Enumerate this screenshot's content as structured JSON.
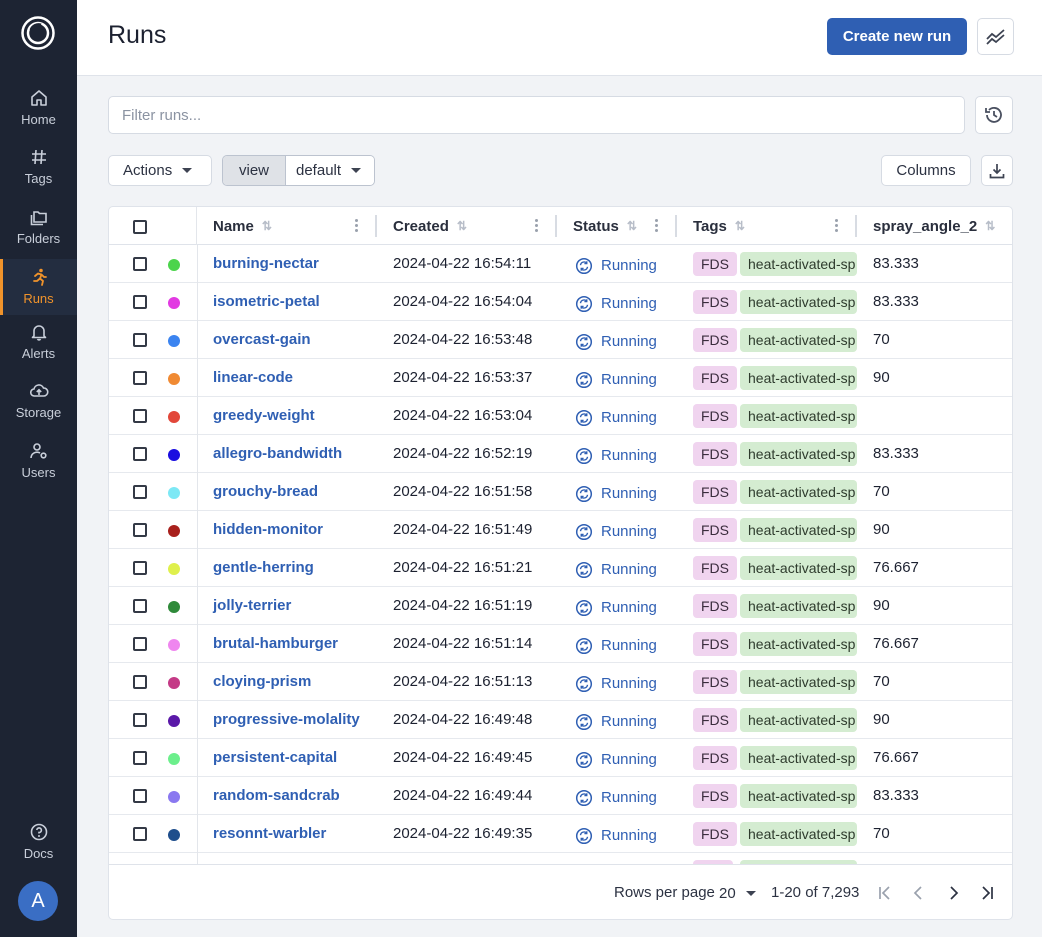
{
  "app": {
    "title": "Runs"
  },
  "sidebar": {
    "items": [
      {
        "label": "Home",
        "icon": "home-icon"
      },
      {
        "label": "Tags",
        "icon": "hash-icon"
      },
      {
        "label": "Folders",
        "icon": "folders-icon"
      },
      {
        "label": "Runs",
        "icon": "runner-icon",
        "active": true
      },
      {
        "label": "Alerts",
        "icon": "bell-icon"
      },
      {
        "label": "Storage",
        "icon": "cloud-upload-icon"
      },
      {
        "label": "Users",
        "icon": "users-cog-icon"
      }
    ],
    "docs_label": "Docs",
    "avatar_initial": "A"
  },
  "header": {
    "title": "Runs",
    "create_button": "Create new run"
  },
  "filter": {
    "placeholder": "Filter runs..."
  },
  "toolbar": {
    "actions_label": "Actions",
    "view_label": "view",
    "view_value": "default",
    "columns_label": "Columns"
  },
  "table": {
    "columns": [
      "Name",
      "Created",
      "Status",
      "Tags",
      "spray_angle_2"
    ],
    "rows": [
      {
        "color": "#4cd44c",
        "name": "burning-nectar",
        "created": "2024-04-22 16:54:11",
        "status": "Running",
        "tag1": "FDS",
        "tag2": "heat-activated-sp",
        "spray": "83.333"
      },
      {
        "color": "#e23ae2",
        "name": "isometric-petal",
        "created": "2024-04-22 16:54:04",
        "status": "Running",
        "tag1": "FDS",
        "tag2": "heat-activated-sp",
        "spray": "83.333"
      },
      {
        "color": "#3b84f0",
        "name": "overcast-gain",
        "created": "2024-04-22 16:53:48",
        "status": "Running",
        "tag1": "FDS",
        "tag2": "heat-activated-sp",
        "spray": "70"
      },
      {
        "color": "#f08a33",
        "name": "linear-code",
        "created": "2024-04-22 16:53:37",
        "status": "Running",
        "tag1": "FDS",
        "tag2": "heat-activated-sp",
        "spray": "90"
      },
      {
        "color": "#e2473a",
        "name": "greedy-weight",
        "created": "2024-04-22 16:53:04",
        "status": "Running",
        "tag1": "FDS",
        "tag2": "heat-activated-sp",
        "spray": ""
      },
      {
        "color": "#1a0ee0",
        "name": "allegro-bandwidth",
        "created": "2024-04-22 16:52:19",
        "status": "Running",
        "tag1": "FDS",
        "tag2": "heat-activated-sp",
        "spray": "83.333"
      },
      {
        "color": "#7de8f5",
        "name": "grouchy-bread",
        "created": "2024-04-22 16:51:58",
        "status": "Running",
        "tag1": "FDS",
        "tag2": "heat-activated-sp",
        "spray": "70"
      },
      {
        "color": "#a8201c",
        "name": "hidden-monitor",
        "created": "2024-04-22 16:51:49",
        "status": "Running",
        "tag1": "FDS",
        "tag2": "heat-activated-sp",
        "spray": "90"
      },
      {
        "color": "#dff04c",
        "name": "gentle-herring",
        "created": "2024-04-22 16:51:21",
        "status": "Running",
        "tag1": "FDS",
        "tag2": "heat-activated-sp",
        "spray": "76.667"
      },
      {
        "color": "#2f8a3a",
        "name": "jolly-terrier",
        "created": "2024-04-22 16:51:19",
        "status": "Running",
        "tag1": "FDS",
        "tag2": "heat-activated-sp",
        "spray": "90"
      },
      {
        "color": "#ef86ef",
        "name": "brutal-hamburger",
        "created": "2024-04-22 16:51:14",
        "status": "Running",
        "tag1": "FDS",
        "tag2": "heat-activated-sp",
        "spray": "76.667"
      },
      {
        "color": "#c43a86",
        "name": "cloying-prism",
        "created": "2024-04-22 16:51:13",
        "status": "Running",
        "tag1": "FDS",
        "tag2": "heat-activated-sp",
        "spray": "70"
      },
      {
        "color": "#5a18a8",
        "name": "progressive-molality",
        "created": "2024-04-22 16:49:48",
        "status": "Running",
        "tag1": "FDS",
        "tag2": "heat-activated-sp",
        "spray": "90"
      },
      {
        "color": "#6cef8c",
        "name": "persistent-capital",
        "created": "2024-04-22 16:49:45",
        "status": "Running",
        "tag1": "FDS",
        "tag2": "heat-activated-sp",
        "spray": "76.667"
      },
      {
        "color": "#8a78f0",
        "name": "random-sandcrab",
        "created": "2024-04-22 16:49:44",
        "status": "Running",
        "tag1": "FDS",
        "tag2": "heat-activated-sp",
        "spray": "83.333"
      },
      {
        "color": "#1f4e8c",
        "name": "resonnt-warbler",
        "created": "2024-04-22 16:49:35",
        "status": "Running",
        "tag1": "FDS",
        "tag2": "heat-activated-sp",
        "spray": "70"
      },
      {
        "color": "#ccc",
        "name": "",
        "created": "",
        "status": "",
        "tag1": "",
        "tag2": "",
        "spray": ""
      }
    ]
  },
  "pagination": {
    "rows_per_page_label": "Rows per page",
    "rows_per_page_value": "20",
    "range_label": "1-20 of 7,293"
  },
  "colors": {
    "accent": "#2f5fb3",
    "sidebar_bg": "#1d2433",
    "active_nav": "#f0932b"
  }
}
